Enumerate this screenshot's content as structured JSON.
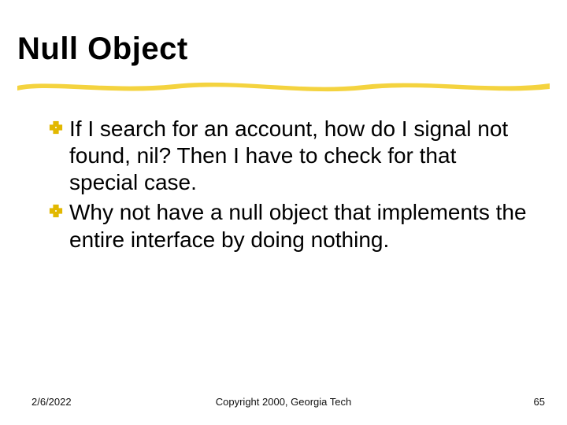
{
  "title": "Null Object",
  "bullets": [
    "If I search for an account, how do I signal not found, nil?  Then I have to check for that special case.",
    "Why not have a null object that implements the entire interface by doing nothing."
  ],
  "footer": {
    "date": "2/6/2022",
    "copyright": "Copyright 2000, Georgia Tech",
    "page": "65"
  },
  "colors": {
    "highlight": "#f4d33f",
    "bullet": "#e2b800"
  }
}
